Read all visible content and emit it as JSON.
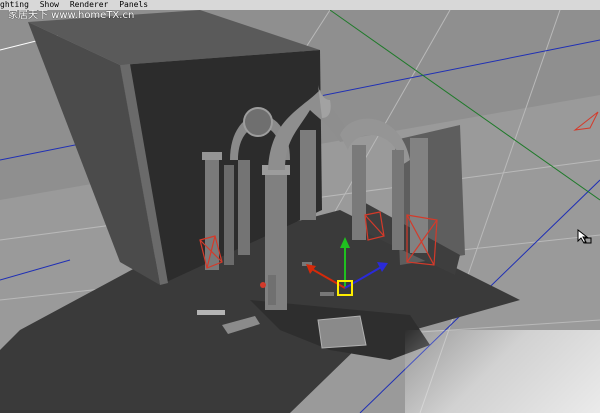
{
  "menu": {
    "items": [
      "ghting",
      "Show",
      "Renderer",
      "Panels"
    ]
  },
  "watermark": {
    "text": "家居天下 www.homeTX.cn"
  },
  "colors": {
    "menu_bg": "#d8d8d8",
    "viewport_bg": "#8f8f8f",
    "ground": "#3a3a3a",
    "grid_blue": "#1f2fb5",
    "grid_green": "#1f7a2a",
    "manipulator_x": "#d42a0a",
    "manipulator_y": "#1fc01f",
    "manipulator_z": "#2a2ad8",
    "selection": "#ffee00",
    "light_red": "#d43a2a"
  },
  "icons": [
    "translate-manipulator",
    "mouse-cursor-icon",
    "spot-light-icon"
  ]
}
